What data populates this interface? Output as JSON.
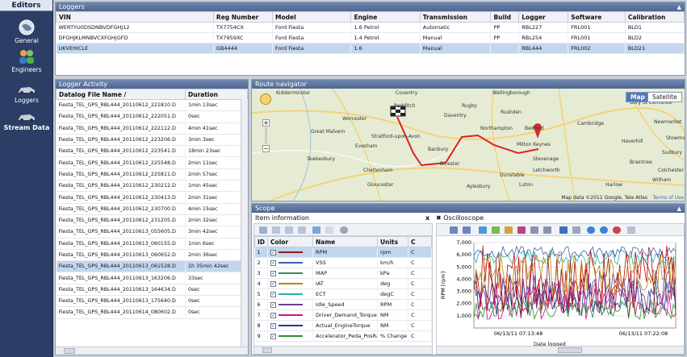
{
  "sidebar": {
    "title": "Editors",
    "items": [
      {
        "label": "General",
        "icon": "globe-icon"
      },
      {
        "label": "Engineers",
        "icon": "people-icon"
      },
      {
        "label": "Loggers",
        "icon": "car-icon"
      },
      {
        "label": "Stream Data",
        "icon": "car-stream-icon"
      }
    ]
  },
  "loggers": {
    "title": "Loggers",
    "columns": [
      "VIN",
      "Reg Number",
      "Model",
      "Engine",
      "Transmission",
      "Build",
      "Logger",
      "Software",
      "Calibration"
    ],
    "rows": [
      [
        "WERTYU0DSDNBVDFGHJ12",
        "TX7754CX",
        "Ford Fiesta",
        "1.6 Petrol",
        "Automatic",
        "PP",
        "RBL227",
        "FRL001",
        "BLD1"
      ],
      [
        "DFGHJKLMNBVCXFGHJGFD",
        "TX7959XC",
        "Ford Fiesta",
        "1.4 Petrol",
        "Manual",
        "PP",
        "RBL254",
        "FRL001",
        "BLD2"
      ],
      [
        "UKVEHICLE",
        "GB4444",
        "Ford Fiesta",
        "1.6",
        "Manual",
        "",
        "RBL444",
        "FRL002",
        "BLD21"
      ]
    ]
  },
  "activity": {
    "title": "Logger Activity",
    "columns": [
      "Datalog File Name /",
      "Duration"
    ],
    "rows": [
      [
        "Fiesta_TEL_GPS_RBL444_20110612_221810.D",
        "1min 13sec"
      ],
      [
        "Fiesta_TEL_GPS_RBL444_20110612_222051.D",
        "0sec"
      ],
      [
        "Fiesta_TEL_GPS_RBL444_20110612_222112.D",
        "4min 41sec"
      ],
      [
        "Fiesta_TEL_GPS_RBL444_20110612_223206.D",
        "3min 3sec"
      ],
      [
        "Fiesta_TEL_GPS_RBL444_20110612_223541.D",
        "18min 23sec"
      ],
      [
        "Fiesta_TEL_GPS_RBL444_20110612_225548.D",
        "2min 11sec"
      ],
      [
        "Fiesta_TEL_GPS_RBL444_20110612_225811.D",
        "2min 57sec"
      ],
      [
        "Fiesta_TEL_GPS_RBL444_20110612_230212.D",
        "1min 45sec"
      ],
      [
        "Fiesta_TEL_GPS_RBL444_20110612_230413.D",
        "2min 31sec"
      ],
      [
        "Fiesta_TEL_GPS_RBL444_20110612_230700.D",
        "4min 15sec"
      ],
      [
        "Fiesta_TEL_GPS_RBL444_20110612_231205.D",
        "2min 32sec"
      ],
      [
        "Fiesta_TEL_GPS_RBL444_20110613_055605.D",
        "3min 42sec"
      ],
      [
        "Fiesta_TEL_GPS_RBL444_20110613_060155.D",
        "1min 6sec"
      ],
      [
        "Fiesta_TEL_GPS_RBL444_20110613_060652.D",
        "2min 36sec"
      ],
      [
        "Fiesta_TEL_GPS_RBL444_20110613_061528.D",
        "1h 35min 42sec"
      ],
      [
        "Fiesta_TEL_GPS_RBL444_20110613_163206.D",
        "33sec"
      ],
      [
        "Fiesta_TEL_GPS_RBL444_20110613_164634.D",
        "0sec"
      ],
      [
        "Fiesta_TEL_GPS_RBL444_20110613_175640.D",
        "0sec"
      ],
      [
        "Fiesta_TEL_GPS_RBL444_20110614_080602.D",
        "0sec"
      ]
    ]
  },
  "map": {
    "title": "Route navigator",
    "map_label": "Map",
    "satellite_label": "Satellite",
    "attribution": "Map data ©2011 Google, Tele Atlas",
    "terms": "Terms of Use",
    "towns": [
      "Kidderminster",
      "Coventry",
      "Rugby",
      "Redditch",
      "Daventry",
      "Wellingborough",
      "Bury St Edmunds",
      "Worcester",
      "Rushden",
      "Northampton",
      "Bedford",
      "Cambridge",
      "Newmarket",
      "Great Malvern",
      "Stratford-upon-Avon",
      "Stowmarket",
      "Evesham",
      "Banbury",
      "Milton Keynes",
      "Haverhill",
      "Sudbury",
      "Tewkesbury",
      "Bicester",
      "Stevenage",
      "Braintree",
      "Colchester",
      "Cheltenham",
      "Letchworth",
      "Witham",
      "Gloucester",
      "Luton",
      "Aylesbury",
      "Dunstable",
      "Harlow"
    ],
    "route_color": "#e02020"
  },
  "scope": {
    "title": "Scope",
    "item_info_title": "Item information",
    "osc_title": "Oscilloscope",
    "close_label": "x",
    "columns": [
      "ID",
      "Color",
      "Name",
      "Units",
      "C"
    ],
    "rows": [
      {
        "id": "1",
        "color": "#8b1a1a",
        "name": "RPM",
        "units": "rpm",
        "c": "C",
        "checked": true
      },
      {
        "id": "2",
        "color": "#3f5fa8",
        "name": "VSS",
        "units": "km/h",
        "c": "C",
        "checked": true
      },
      {
        "id": "3",
        "color": "#2e8b57",
        "name": "MAP",
        "units": "kPa",
        "c": "C",
        "checked": true
      },
      {
        "id": "4",
        "color": "#b8860b",
        "name": "IAT",
        "units": "deg",
        "c": "C",
        "checked": true
      },
      {
        "id": "5",
        "color": "#20b2aa",
        "name": "ECT",
        "units": "degC",
        "c": "C",
        "checked": true
      },
      {
        "id": "6",
        "color": "#6a3d9a",
        "name": "Idle_Speed",
        "units": "RPM",
        "c": "C",
        "checked": true
      },
      {
        "id": "7",
        "color": "#c71585",
        "name": "Driver_Demand_Torque",
        "units": "NM",
        "c": "C",
        "checked": true
      },
      {
        "id": "8",
        "color": "#1e3a8a",
        "name": "Actual_EngineTorque",
        "units": "NM",
        "c": "C",
        "checked": true
      },
      {
        "id": "9",
        "color": "#2f8f2f",
        "name": "Accelerator_Peda_PosRa",
        "units": "% Change P",
        "c": "C",
        "checked": true
      }
    ]
  },
  "chart_data": {
    "type": "line",
    "ylabel": "RPM [rpm]",
    "xlabel": "Date logged",
    "x_ticks": [
      "06/13/11 07:13:48",
      "06/13/11 07:22:08"
    ],
    "y_ticks": [
      1000,
      2000,
      3000,
      4000,
      5000,
      6000,
      7000
    ],
    "y_tick_labels": [
      "1,000",
      "2,000",
      "3,000",
      "4,000",
      "5,000",
      "6,000",
      "7,000"
    ],
    "ylim": [
      0,
      7000
    ],
    "series_colors": [
      "#8b1a1a",
      "#c40000",
      "#1e3a8a",
      "#20b2aa",
      "#6a3d9a",
      "#c71585",
      "#b8860b",
      "#2f8f2f",
      "#3f5fa8"
    ]
  }
}
